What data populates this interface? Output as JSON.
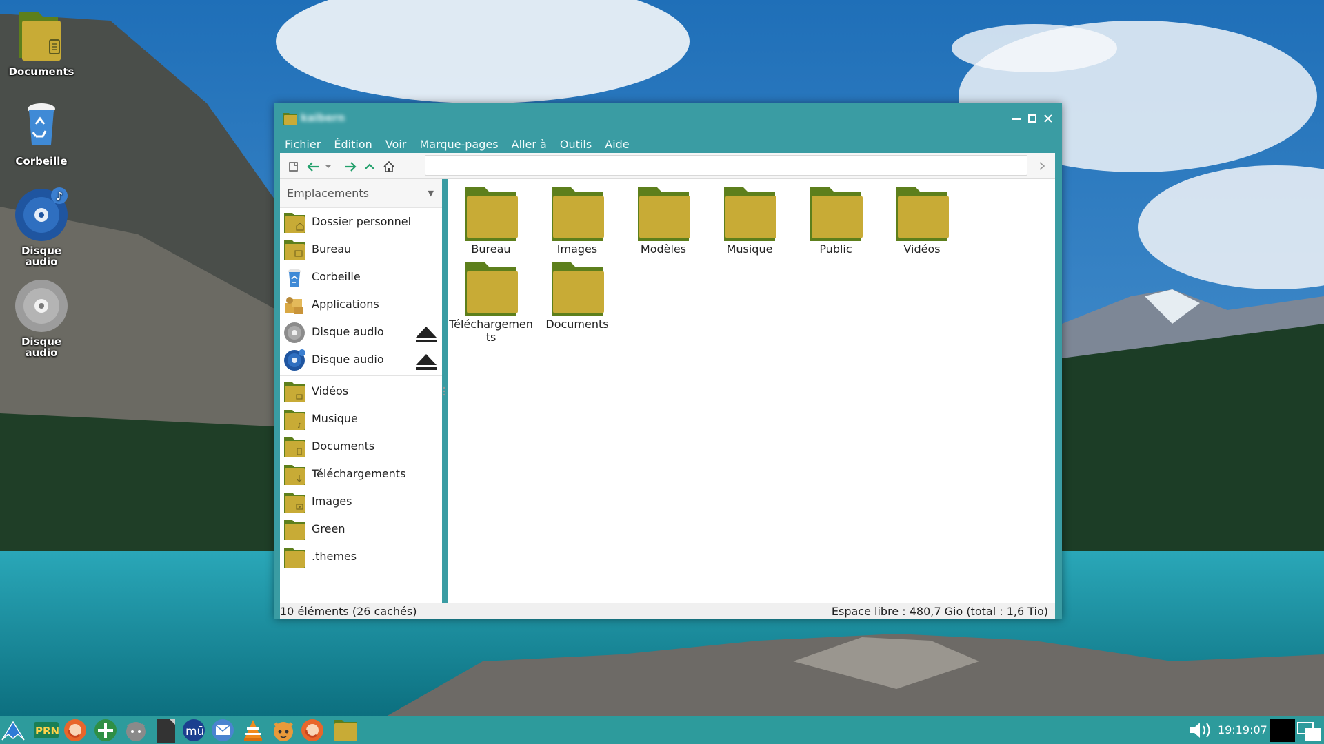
{
  "desktop": {
    "icons": [
      {
        "label": "Documents",
        "icon": "folder-documents-icon"
      },
      {
        "label": "Corbeille",
        "icon": "trash-icon"
      },
      {
        "label": "Disque audio",
        "icon": "audio-disc-icon"
      },
      {
        "label": "Disque audio",
        "icon": "disc-icon"
      }
    ]
  },
  "window": {
    "title": "kaibern",
    "menu": [
      "Fichier",
      "Édition",
      "Voir",
      "Marque-pages",
      "Aller à",
      "Outils",
      "Aide"
    ],
    "location": "",
    "sidebar": {
      "header": "Emplacements",
      "devices": [
        {
          "label": "Dossier personnel",
          "icon": "home-folder-icon"
        },
        {
          "label": "Bureau",
          "icon": "desktop-folder-icon"
        },
        {
          "label": "Corbeille",
          "icon": "trash-icon"
        },
        {
          "label": "Applications",
          "icon": "applications-icon"
        },
        {
          "label": "Disque audio",
          "icon": "disc-icon",
          "eject": true
        },
        {
          "label": "Disque audio",
          "icon": "audio-disc-icon",
          "eject": true
        }
      ],
      "bookmarks": [
        {
          "label": "Vidéos",
          "icon": "videos-folder-icon"
        },
        {
          "label": "Musique",
          "icon": "music-folder-icon"
        },
        {
          "label": "Documents",
          "icon": "documents-folder-icon"
        },
        {
          "label": "Téléchargements",
          "icon": "downloads-folder-icon"
        },
        {
          "label": "Images",
          "icon": "pictures-folder-icon"
        },
        {
          "label": "Green",
          "icon": "folder-icon"
        },
        {
          "label": ".themes",
          "icon": "folder-icon"
        }
      ]
    },
    "files": [
      "Bureau",
      "Images",
      "Modèles",
      "Musique",
      "Public",
      "Vidéos",
      "Téléchargements",
      "Documents"
    ],
    "status": {
      "count": "10 éléments (26 cachés)",
      "free_space": "Espace libre : 480,7 Gio (total : 1,6 Tio)"
    }
  },
  "taskbar": {
    "launchers": [
      "menu-icon",
      "prn-icon",
      "firefox-icon",
      "green-app-icon",
      "cat-app-icon",
      "terminal-icon",
      "mu-icon",
      "mail-icon",
      "vlc-icon",
      "fox-app-icon",
      "firefox-icon",
      "folder-icon"
    ],
    "clock": "19:19:07"
  },
  "colors": {
    "window_accent": "#3a9ca3",
    "taskbar": "#2d9b9c",
    "folder_body": "#c8ab36",
    "folder_tab": "#5d7f1c"
  }
}
